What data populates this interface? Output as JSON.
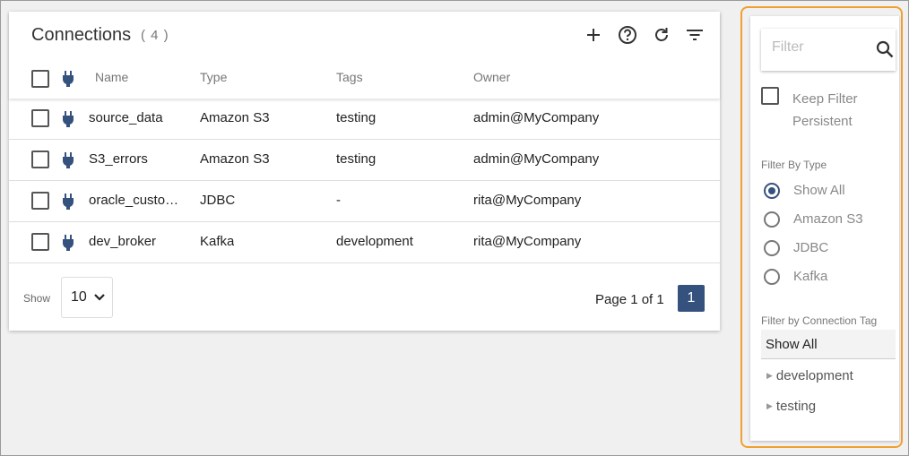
{
  "header": {
    "title": "Connections",
    "count": "( 4 )"
  },
  "toolbar": {
    "icons": [
      "add-icon",
      "help-icon",
      "refresh-icon",
      "filter-icon"
    ]
  },
  "table": {
    "columns": [
      "Name",
      "Type",
      "Tags",
      "Owner"
    ],
    "rows": [
      {
        "name": "source_data",
        "type": "Amazon S3",
        "tags": "testing",
        "owner": "admin@MyCompany"
      },
      {
        "name": "S3_errors",
        "type": "Amazon S3",
        "tags": "testing",
        "owner": "admin@MyCompany"
      },
      {
        "name": "oracle_customers",
        "type": "JDBC",
        "tags": "-",
        "owner": "rita@MyCompany"
      },
      {
        "name": "dev_broker",
        "type": "Kafka",
        "tags": "development",
        "owner": "rita@MyCompany"
      }
    ]
  },
  "footer": {
    "show_label": "Show",
    "page_size": "10",
    "page_info": "Page 1 of 1",
    "current_page": "1"
  },
  "sidebar": {
    "filter_placeholder": "Filter",
    "keep_filter_label": "Keep Filter Persistent",
    "filter_by_type_label": "Filter By Type",
    "type_options": [
      "Show All",
      "Amazon S3",
      "JDBC",
      "Kafka"
    ],
    "selected_type": "Show All",
    "filter_by_tag_label": "Filter by Connection Tag",
    "tag_show_all": "Show All",
    "tags": [
      "development",
      "testing"
    ]
  },
  "colors": {
    "accent": "#35527f",
    "highlight_outline": "#f0a030"
  }
}
